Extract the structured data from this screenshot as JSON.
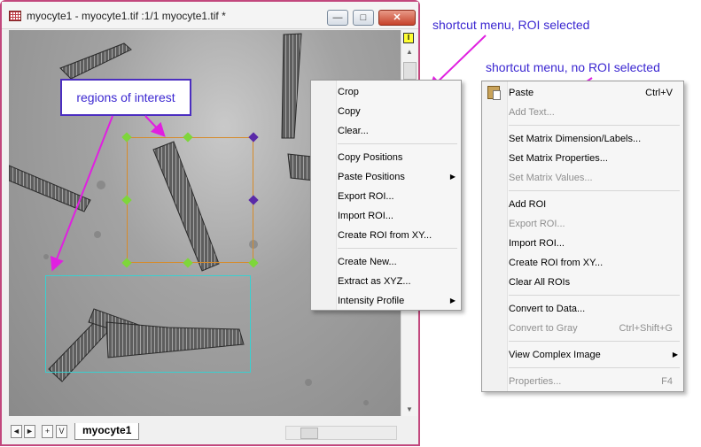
{
  "window": {
    "title": "myocyte1 - myocyte1.tif :1/1 myocyte1.tif *",
    "minimize": "—",
    "restore": "□",
    "close": "✕",
    "roi_marker": "I",
    "sheet_tab": "myocyte1",
    "nav": [
      "◄",
      "►",
      "+",
      "V"
    ]
  },
  "annotations": {
    "roi_selected": "shortcut menu, ROI selected",
    "no_roi_selected": "shortcut menu, no ROI selected",
    "regions_of_interest": "regions of interest"
  },
  "menu_roi": {
    "items": [
      {
        "label": "Crop"
      },
      {
        "label": "Copy"
      },
      {
        "label": "Clear..."
      },
      {
        "label": "Copy Positions"
      },
      {
        "label": "Paste Positions",
        "submenu": true
      },
      {
        "label": "Export ROI..."
      },
      {
        "label": "Import ROI..."
      },
      {
        "label": "Create ROI from XY..."
      },
      {
        "label": "Create New..."
      },
      {
        "label": "Extract as XYZ..."
      },
      {
        "label": "Intensity Profile",
        "submenu": true
      }
    ]
  },
  "menu_noroi": {
    "items": [
      {
        "label": "Paste",
        "shortcut": "Ctrl+V",
        "icon": "paste-icon"
      },
      {
        "label": "Add Text...",
        "disabled": true
      },
      {
        "label": "Set Matrix Dimension/Labels..."
      },
      {
        "label": "Set Matrix Properties..."
      },
      {
        "label": "Set Matrix Values...",
        "disabled": true
      },
      {
        "label": "Add ROI"
      },
      {
        "label": "Export ROI...",
        "disabled": true
      },
      {
        "label": "Import ROI..."
      },
      {
        "label": "Create ROI from XY..."
      },
      {
        "label": "Clear All ROIs"
      },
      {
        "label": "Convert to Data..."
      },
      {
        "label": "Convert to Gray",
        "shortcut": "Ctrl+Shift+G",
        "disabled": true
      },
      {
        "label": "View Complex Image",
        "submenu": true
      },
      {
        "label": "Properties...",
        "shortcut": "F4",
        "disabled": true
      }
    ]
  },
  "colors": {
    "annotation": "#3b27d1",
    "arrow": "#e020e0",
    "window_border": "#c2477d",
    "roi_orange": "#d68b2a",
    "roi_cyan": "#39d0d0"
  }
}
